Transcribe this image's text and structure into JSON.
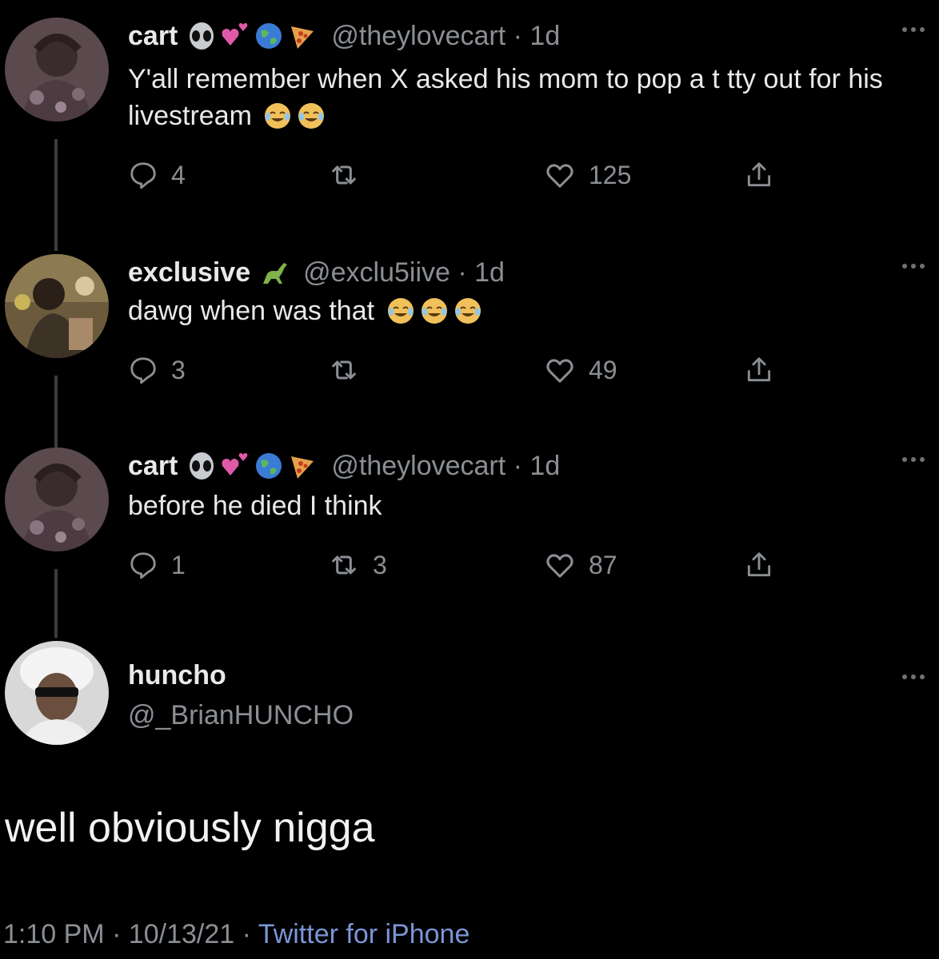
{
  "tweets": [
    {
      "name": "cart",
      "name_emojis": [
        "alien-icon",
        "hearts-icon",
        "globe-icon",
        "pizza-icon"
      ],
      "handle": "@theylovecart · 1d",
      "text": "Y'all remember when X asked his mom to pop a  t tty out for his livestream",
      "text_emojis": [
        "crying-laughing-icon",
        "crying-laughing-icon"
      ],
      "replies": "4",
      "retweets": "",
      "likes": "125"
    },
    {
      "name": "exclusive",
      "name_emojis": [
        "dinosaur-icon"
      ],
      "handle": "@exclu5iive · 1d",
      "text": "dawg when was that",
      "text_emojis": [
        "crying-laughing-icon",
        "crying-laughing-icon",
        "crying-laughing-icon"
      ],
      "replies": "3",
      "retweets": "",
      "likes": "49"
    },
    {
      "name": "cart",
      "name_emojis": [
        "alien-icon",
        "hearts-icon",
        "globe-icon",
        "pizza-icon"
      ],
      "handle": "@theylovecart · 1d",
      "text": "before he died I think",
      "text_emojis": [],
      "replies": "1",
      "retweets": "3",
      "likes": "87"
    }
  ],
  "main": {
    "name": "huncho",
    "handle": "@_BrianHUNCHO",
    "text": "well obviously nigga",
    "time": "1:10 PM · 10/13/21 · ",
    "source": "Twitter for iPhone"
  },
  "colors": {
    "background": "#000000",
    "text": "#e7e9ea",
    "muted": "#8b8f94",
    "link": "#7b96d6"
  }
}
